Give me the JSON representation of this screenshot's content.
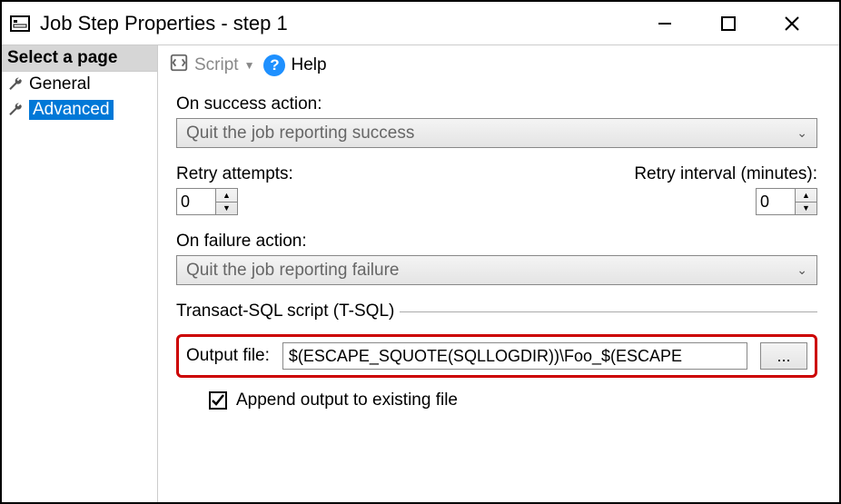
{
  "window": {
    "title": "Job Step Properties - step 1"
  },
  "sidebar": {
    "header": "Select a page",
    "items": [
      {
        "label": "General",
        "selected": false
      },
      {
        "label": "Advanced",
        "selected": true
      }
    ]
  },
  "toolbar": {
    "script_label": "Script",
    "help_label": "Help"
  },
  "form": {
    "on_success_label": "On success action:",
    "on_success_value": "Quit the job reporting success",
    "retry_attempts_label": "Retry attempts:",
    "retry_attempts_value": "0",
    "retry_interval_label": "Retry interval (minutes):",
    "retry_interval_value": "0",
    "on_failure_label": "On failure action:",
    "on_failure_value": "Quit the job reporting failure",
    "tsql_group_label": "Transact-SQL script (T-SQL)",
    "output_file_label": "Output file:",
    "output_file_value": "$(ESCAPE_SQUOTE(SQLLOGDIR))\\Foo_$(ESCAPE",
    "browse_label": "...",
    "append_label": "Append output to existing file",
    "append_checked": true
  }
}
